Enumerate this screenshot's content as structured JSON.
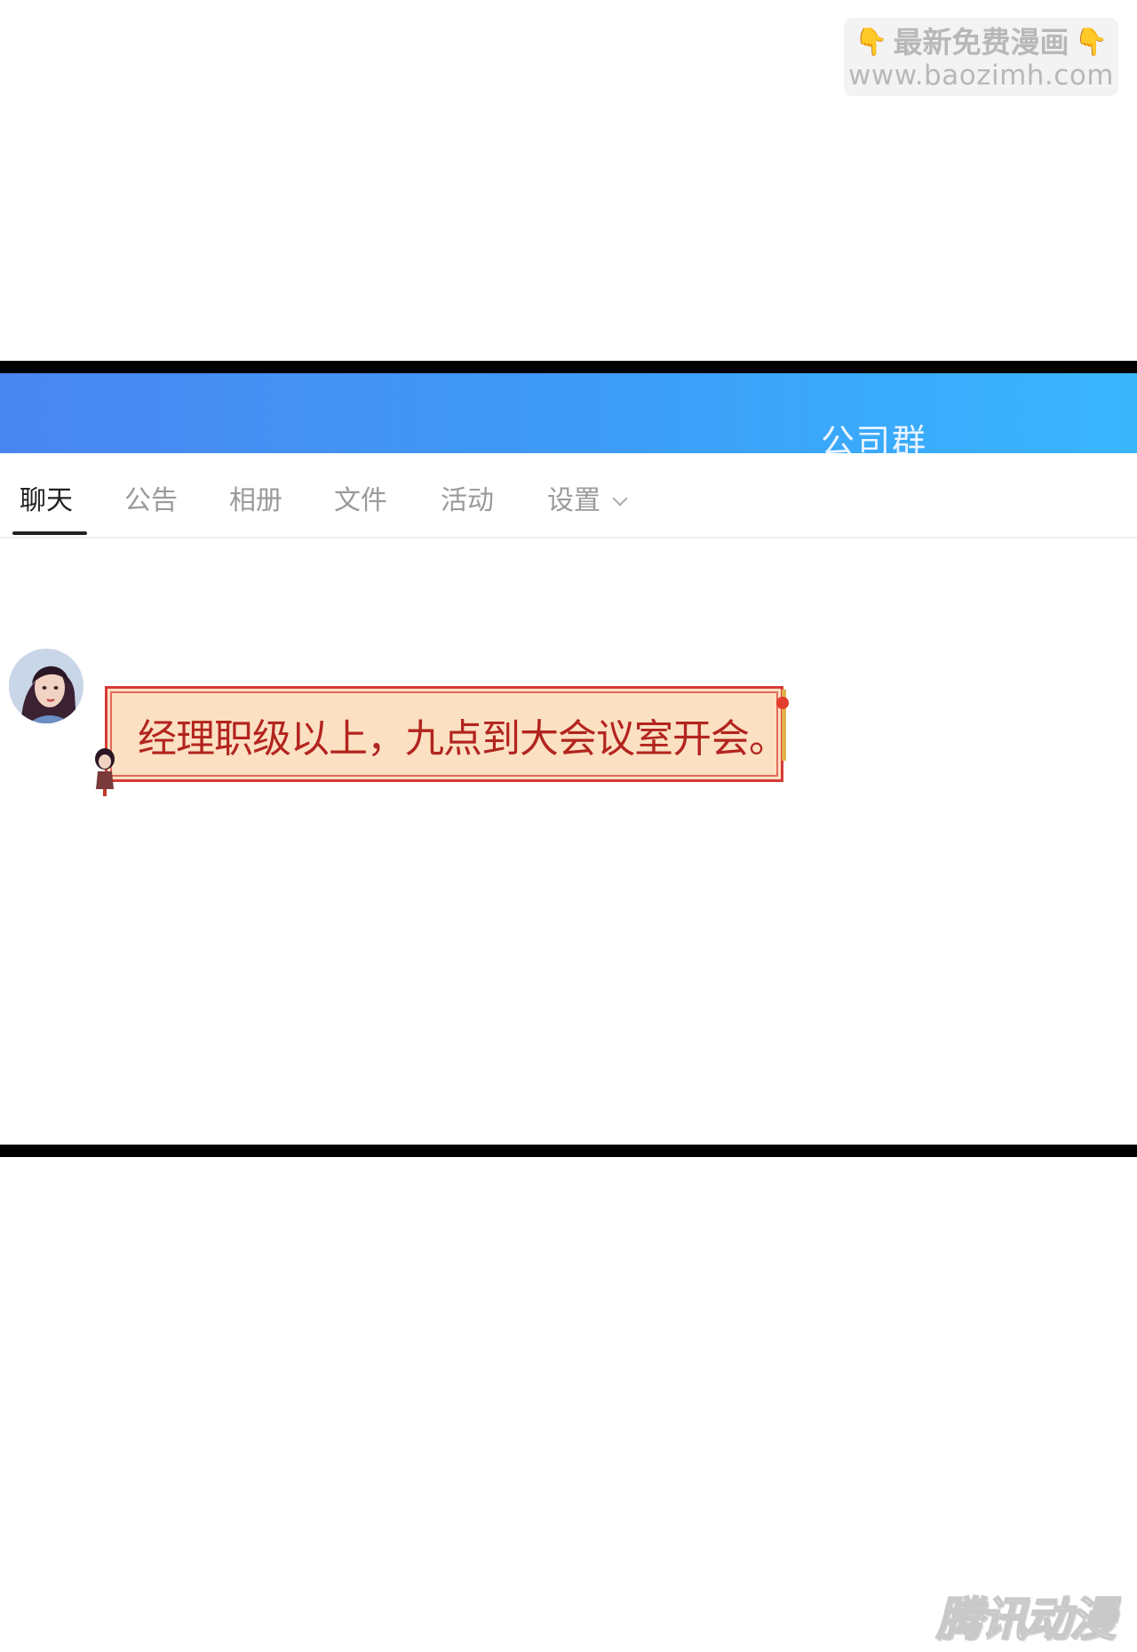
{
  "watermark": {
    "line1": "最新免费漫画",
    "line2": "www.baozimh.com",
    "hand_icon": "pointing-down-hand-icon"
  },
  "titlebar": {
    "title": "公司群",
    "gradient": [
      "#4a86f0",
      "#3ab6fd"
    ]
  },
  "tabs": [
    {
      "label": "聊天",
      "active": true
    },
    {
      "label": "公告",
      "active": false
    },
    {
      "label": "相册",
      "active": false
    },
    {
      "label": "文件",
      "active": false
    },
    {
      "label": "活动",
      "active": false
    },
    {
      "label": "设置",
      "active": false,
      "dropdown": true
    }
  ],
  "message": {
    "text": "经理职级以上，九点到大会议室开会。",
    "bubble_fill": "#fbe0c2",
    "bubble_border": "#d63a36",
    "text_color": "#b3241f"
  },
  "logo": {
    "text": "腾讯动漫"
  }
}
